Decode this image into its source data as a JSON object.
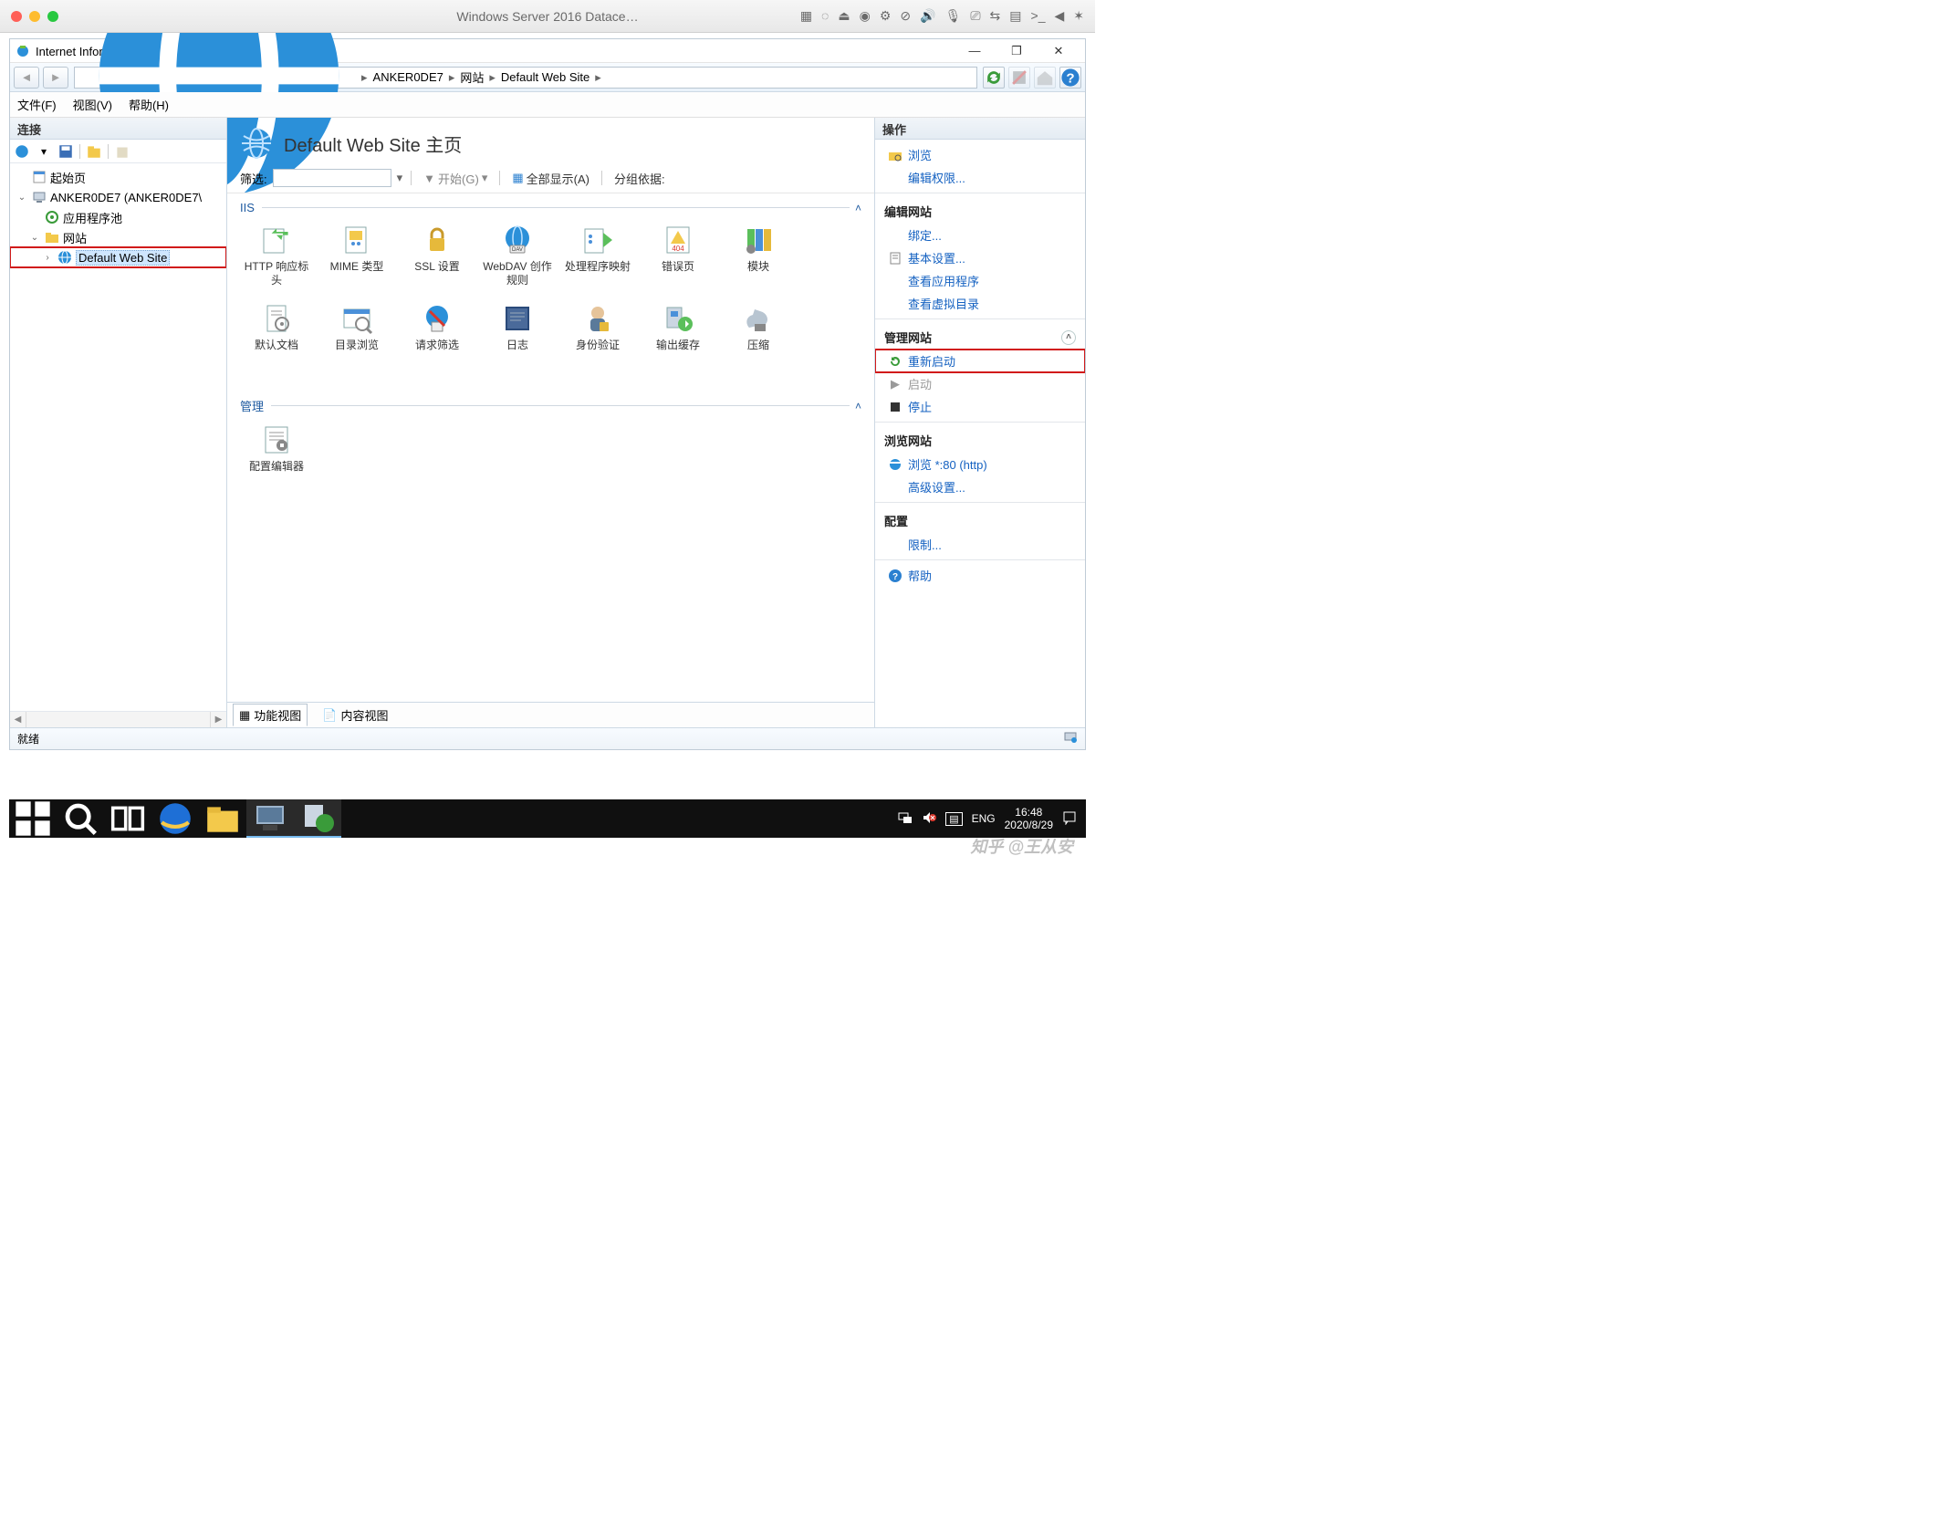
{
  "mac": {
    "title": "Windows Server 2016 Datace…",
    "icons": [
      "▦",
      "◌",
      "⏏",
      "◉",
      "⚙",
      "⊘",
      "🔊",
      "🎙",
      "⎚",
      "⇆",
      "▤",
      ">_",
      "◀",
      "✶"
    ]
  },
  "app": {
    "title": "Internet Information Services (IIS)管理器",
    "breadcrumb": [
      "ANKER0DE7",
      "网站",
      "Default Web Site"
    ],
    "menu": {
      "file": "文件(F)",
      "view": "视图(V)",
      "help": "帮助(H)"
    }
  },
  "panels": {
    "left": "连接",
    "right": "操作"
  },
  "tree": {
    "start": "起始页",
    "server": "ANKER0DE7 (ANKER0DE7\\",
    "apppools": "应用程序池",
    "sites": "网站",
    "dws": "Default Web Site"
  },
  "center": {
    "title": "Default Web Site 主页",
    "filter_label": "筛选:",
    "filter_value": "",
    "start_btn": "开始(G)",
    "showall": "全部显示(A)",
    "groupby": "分组依据:",
    "groups": {
      "iis": "IIS",
      "mgmt": "管理"
    },
    "iis_items": [
      "HTTP 响应标头",
      "MIME 类型",
      "SSL 设置",
      "WebDAV 创作规则",
      "处理程序映射",
      "错误页",
      "模块",
      "默认文档",
      "目录浏览",
      "请求筛选",
      "日志",
      "身份验证",
      "输出缓存",
      "压缩"
    ],
    "mgmt_items": [
      "配置编辑器"
    ],
    "tabs": {
      "features": "功能视图",
      "content": "内容视图"
    }
  },
  "actions": {
    "browse": "浏览",
    "edit_perm": "编辑权限...",
    "sec_edit_site": "编辑网站",
    "bindings": "绑定...",
    "basic": "基本设置...",
    "view_apps": "查看应用程序",
    "view_vdirs": "查看虚拟目录",
    "sec_manage": "管理网站",
    "restart": "重新启动",
    "start": "启动",
    "stop": "停止",
    "sec_browse": "浏览网站",
    "browse80": "浏览 *:80 (http)",
    "adv": "高级设置...",
    "sec_config": "配置",
    "limits": "限制...",
    "help": "帮助"
  },
  "statusbar": {
    "ready": "就绪"
  },
  "taskbar": {
    "tray_lang1": "ENG",
    "tray_time": "16:48",
    "tray_date": "2020/8/29"
  },
  "watermark": "知乎 @王从安"
}
